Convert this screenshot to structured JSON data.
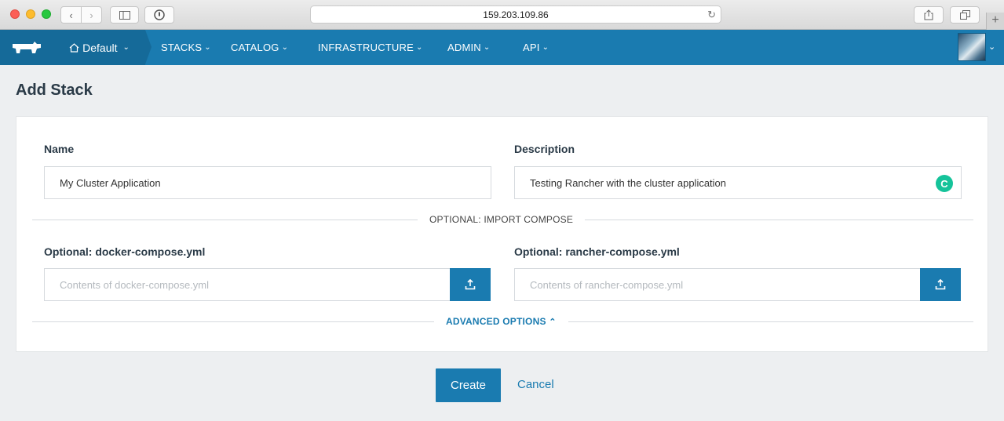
{
  "browser": {
    "url": "159.203.109.86",
    "plus_label": "+"
  },
  "header": {
    "environment": "Default",
    "nav": [
      {
        "label": "STACKS"
      },
      {
        "label": "CATALOG"
      },
      {
        "label": "INFRASTRUCTURE"
      },
      {
        "label": "ADMIN"
      },
      {
        "label": "API"
      }
    ],
    "accent_color": "#1a7bb0",
    "dark_color": "#156a99"
  },
  "page": {
    "title": "Add Stack"
  },
  "form": {
    "name_label": "Name",
    "name_value": "My Cluster Application",
    "description_label": "Description",
    "description_value": "Testing Rancher with the cluster application",
    "import_divider": "OPTIONAL: IMPORT COMPOSE",
    "docker_label": "Optional: docker-compose.yml",
    "docker_placeholder": "Contents of docker-compose.yml",
    "rancher_label": "Optional: rancher-compose.yml",
    "rancher_placeholder": "Contents of rancher-compose.yml",
    "advanced_label": "ADVANCED OPTIONS"
  },
  "actions": {
    "create_label": "Create",
    "cancel_label": "Cancel"
  }
}
